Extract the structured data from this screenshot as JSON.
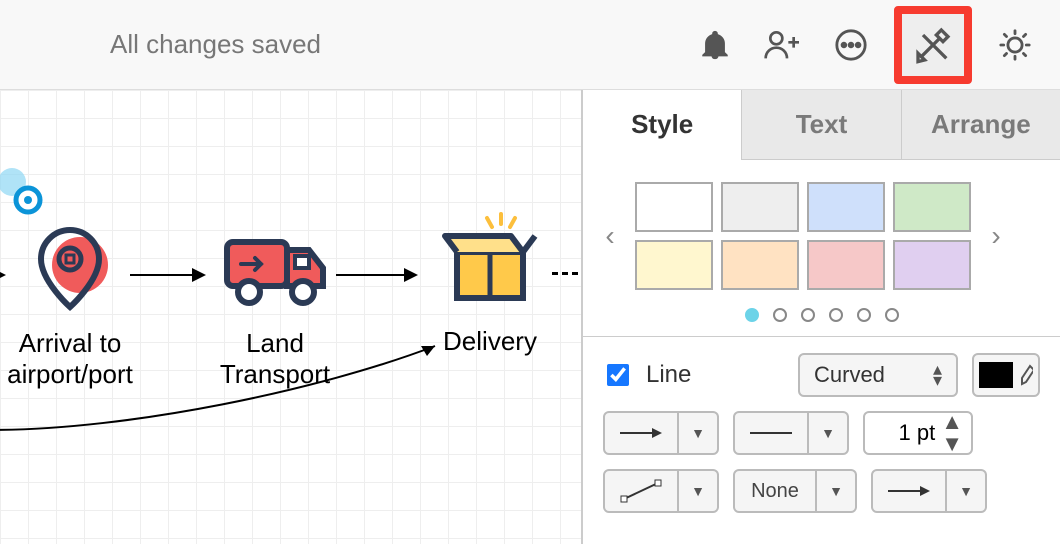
{
  "header": {
    "status": "All changes saved"
  },
  "canvas": {
    "nodes": [
      {
        "id": "arrival",
        "label": "Arrival to\nairport/port"
      },
      {
        "id": "land",
        "label": "Land\nTransport"
      },
      {
        "id": "delivery",
        "label": "Delivery"
      }
    ]
  },
  "panel": {
    "tabs": {
      "style": "Style",
      "text": "Text",
      "arrange": "Arrange",
      "active": "style"
    },
    "swatches": [
      "#ffffff",
      "#eeeeee",
      "#cfe0fb",
      "#cfe9c7",
      "#fff7cf",
      "#ffe2c2",
      "#f6c8c8",
      "#e0cff0"
    ],
    "page_dots": 6,
    "line": {
      "enabled": true,
      "label": "Line",
      "style": "Curved",
      "color": "#000000",
      "width_value": "1 pt",
      "waypoint_label": "None"
    }
  }
}
